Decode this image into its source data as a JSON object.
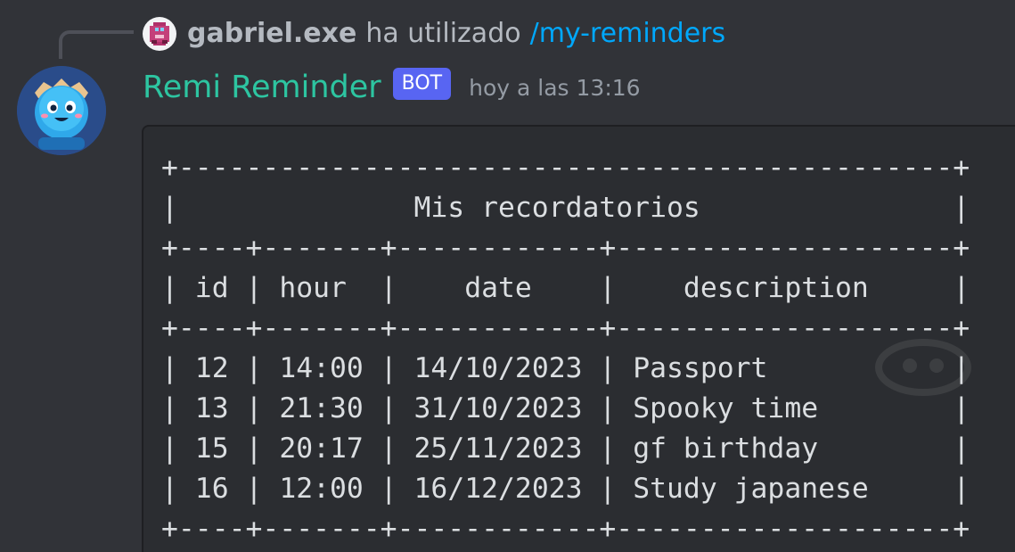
{
  "reply": {
    "username": "gabriel.exe",
    "text": "ha utilizado",
    "command": "/my-reminders",
    "avatar_icon": "pixel-avatar-icon"
  },
  "message": {
    "author": "Remi Reminder",
    "badge": "BOT",
    "timestamp": "hoy a las 13:16",
    "avatar_icon": "blue-blob-mascot-icon"
  },
  "table": {
    "title": "Mis recordatorios",
    "columns": [
      "id",
      "hour",
      "date",
      "description"
    ],
    "rows": [
      [
        "12",
        "14:00",
        "14/10/2023",
        "Passport"
      ],
      [
        "13",
        "21:30",
        "31/10/2023",
        "Spooky time"
      ],
      [
        "15",
        "20:17",
        "25/11/2023",
        "gf birthday"
      ],
      [
        "16",
        "12:00",
        "16/12/2023",
        "Study japanese"
      ]
    ]
  },
  "colors": {
    "background": "#313338",
    "bot_name": "#2dc5a1",
    "badge": "#5865f2",
    "command_link": "#00a8fc",
    "code_background": "#2b2d31"
  }
}
